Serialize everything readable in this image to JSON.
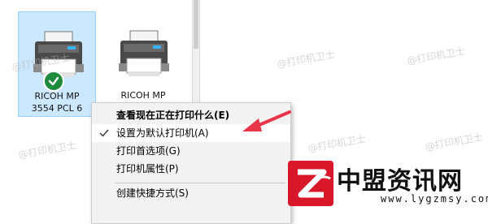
{
  "devices": [
    {
      "name_line1": "RICOH MP",
      "name_line2": "3554 PCL 6",
      "is_default": true,
      "selected": true
    },
    {
      "name_line1": "RICOH MP",
      "name_line2": "",
      "is_default": false,
      "selected": false
    }
  ],
  "context_menu": {
    "items": [
      {
        "label": "查看现在正在打印什么(E)",
        "bold": true,
        "checked": false,
        "highlighted": false
      },
      {
        "label": "设置为默认打印机(A)",
        "bold": false,
        "checked": true,
        "highlighted": true
      },
      {
        "label": "打印首选项(G)",
        "bold": false,
        "checked": false,
        "highlighted": false
      },
      {
        "label": "打印机属性(P)",
        "bold": false,
        "checked": false,
        "highlighted": false
      },
      {
        "label": "创建快捷方式(S)",
        "bold": false,
        "checked": false,
        "highlighted": false
      }
    ]
  },
  "watermark_text": "@打印机卫士",
  "brand": {
    "title": "中盟资讯网",
    "url": "www.lygzmsy.com"
  },
  "colors": {
    "selection_bg": "#cce8ff",
    "default_badge": "#1e8a3c",
    "arrow": "#e8354a",
    "logo_red": "#d9172a"
  },
  "icons": [
    "printer-icon",
    "default-check-icon",
    "check-icon",
    "arrow-icon",
    "brand-logo-icon"
  ]
}
